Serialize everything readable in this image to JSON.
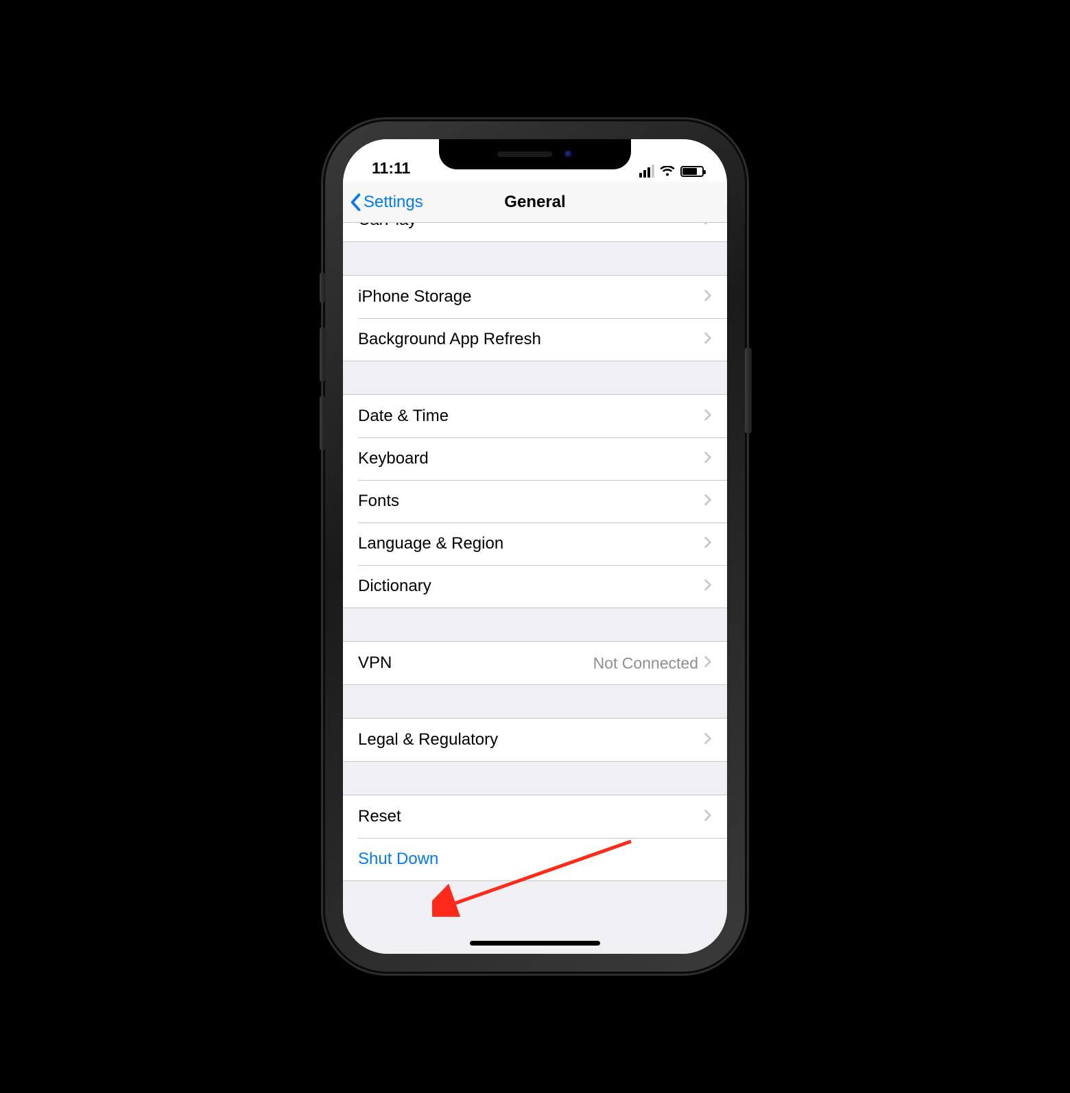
{
  "status_bar": {
    "time": "11:11"
  },
  "nav": {
    "back_label": "Settings",
    "title": "General"
  },
  "rows": {
    "carplay": {
      "label": "CarPlay"
    },
    "storage": {
      "label": "iPhone Storage"
    },
    "bg_refresh": {
      "label": "Background App Refresh"
    },
    "date_time": {
      "label": "Date & Time"
    },
    "keyboard": {
      "label": "Keyboard"
    },
    "fonts": {
      "label": "Fonts"
    },
    "lang_region": {
      "label": "Language & Region"
    },
    "dictionary": {
      "label": "Dictionary"
    },
    "vpn": {
      "label": "VPN",
      "detail": "Not Connected"
    },
    "legal": {
      "label": "Legal & Regulatory"
    },
    "reset": {
      "label": "Reset"
    },
    "shutdown": {
      "label": "Shut Down"
    }
  }
}
